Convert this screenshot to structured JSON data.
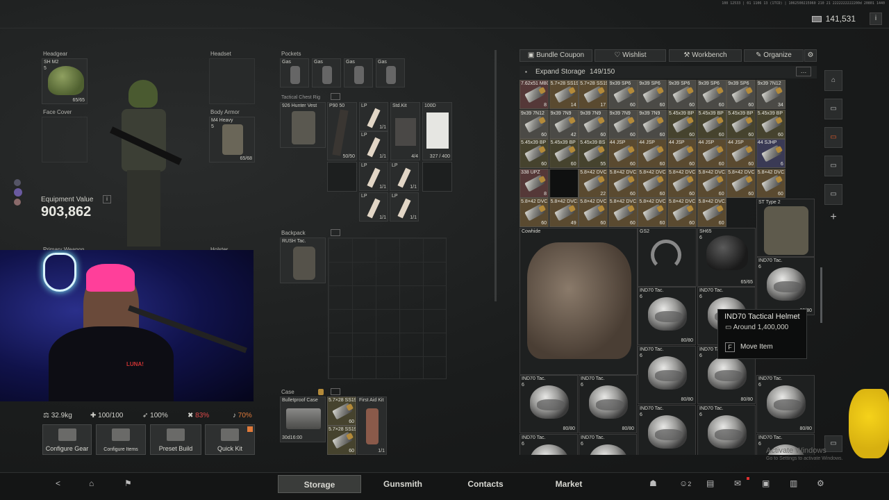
{
  "header": {
    "debug_text": "100 12533 | 01 1106 13 (1TCD) | 1062500215960 210 21 2222222222200d 20801 1440",
    "money": "141,531",
    "info": "i"
  },
  "gear": {
    "headgear_label": "Headgear",
    "headgear_item": "SH M2",
    "headgear_armor": "5",
    "headgear_dur": "65/65",
    "headset_label": "Headset",
    "face_label": "Face Cover",
    "body_label": "Body Armor",
    "body_item": "M4 Heavy",
    "body_armor": "5",
    "body_dur": "65/68",
    "equipment_value_label": "Equipment Value",
    "equipment_value": "903,862",
    "primary_label": "Primary Weapon",
    "holster_label": "Holster"
  },
  "pockets": {
    "label": "Pockets",
    "items": [
      "Gas",
      "Gas",
      "Gas",
      "Gas"
    ]
  },
  "rig": {
    "label": "Tactical Chest Rig",
    "vest": "926 Hunter Vest",
    "p90": "P90 50",
    "p90_count": "50/50",
    "lp": "LP",
    "lp_count": "1/1",
    "stdkit": "Std.Kit",
    "stdkit_count": "4/4",
    "kit100d": "100D",
    "kit100d_count": "327 / 400"
  },
  "backpack": {
    "label": "Backpack",
    "item": "RUSH Tac."
  },
  "case": {
    "label": "Case",
    "item": "Bulletproof Case",
    "timer": "30d16:00",
    "ammo1": "5.7×28 SS190",
    "ammo1_count": "60",
    "ammo2": "5.7×28 SS190",
    "ammo2_count": "60",
    "firstaid": "First Aid Kit",
    "firstaid_count": "1/1"
  },
  "stats": {
    "weight": "32.9kg",
    "health": "100/100",
    "stamina": "100%",
    "hydration": "83%",
    "energy": "70%"
  },
  "actions": [
    "Configure Gear",
    "Configure Items",
    "Preset Build",
    "Quick Kit"
  ],
  "storage": {
    "buttons": [
      "Bundle Coupon",
      "Wishlist",
      "Workbench",
      "Organize"
    ],
    "expand": "Expand Storage",
    "capacity": "149/150",
    "more": "…",
    "rows": [
      [
        [
          "7.62x51 M80",
          "8",
          "g4"
        ],
        [
          "5.7×28 SS190",
          "14",
          "g1"
        ],
        [
          "5.7×28 SS190",
          "17",
          "g1"
        ],
        [
          "9x39 SP6",
          "60",
          "g2"
        ],
        [
          "9x39 SP6",
          "60",
          "g2"
        ],
        [
          "9x39 SP6",
          "60",
          "g2"
        ],
        [
          "9x39 SP6",
          "60",
          "g2"
        ],
        [
          "9x39 SP6",
          "60",
          "g2"
        ],
        [
          "9x39 7N12",
          "34",
          "g2"
        ]
      ],
      [
        [
          "9x39 7N12",
          "60",
          "g2"
        ],
        [
          "9x39 7N9",
          "42",
          "g2"
        ],
        [
          "9x39 7N9",
          "60",
          "g2"
        ],
        [
          "9x39 7N9",
          "60",
          "g2"
        ],
        [
          "9x39 7N9",
          "60",
          "g2"
        ],
        [
          "5.45x39 BP",
          "60",
          "g5"
        ],
        [
          "5.45x39 BP",
          "60",
          "g5"
        ],
        [
          "5.45x39 BP",
          "60",
          "g5"
        ],
        [
          "5.45x39 BP",
          "60",
          "g5"
        ]
      ],
      [
        [
          "5.45x39 BP",
          "60",
          "g5"
        ],
        [
          "5.45x39 BP",
          "60",
          "g5"
        ],
        [
          "5.45x39 BS",
          "55",
          "g5"
        ],
        [
          "44 JSP",
          "60",
          "g1"
        ],
        [
          "44 JSP",
          "60",
          "g1"
        ],
        [
          "44 JSP",
          "60",
          "g1"
        ],
        [
          "44 JSP",
          "60",
          "g1"
        ],
        [
          "44 JSP",
          "60",
          "g1"
        ],
        [
          "44 SJHP",
          "6",
          "g3"
        ]
      ],
      [
        [
          "338 UPZ",
          "8",
          "g4"
        ],
        [
          "",
          "",
          ""
        ],
        [
          "5.8×42 DVC12",
          "22",
          "g1"
        ],
        [
          "5.8×42 DVC12",
          "60",
          "g1"
        ],
        [
          "5.8×42 DVC12",
          "60",
          "g1"
        ],
        [
          "5.8×42 DVC12",
          "60",
          "g1"
        ],
        [
          "5.8×42 DVC12",
          "60",
          "g1"
        ],
        [
          "5.8×42 DVC12",
          "60",
          "g1"
        ],
        [
          "5.8×42 DVC12",
          "60",
          "g1"
        ]
      ],
      [
        [
          "5.8×42 DVC12",
          "60",
          "g1"
        ],
        [
          "5.8×42 DVC12",
          "49",
          "g1"
        ],
        [
          "5.8×42 DVC12",
          "60",
          "g1"
        ],
        [
          "5.8×42 DVC12",
          "60",
          "g1"
        ],
        [
          "5.8×42 DVC12",
          "60",
          "g1"
        ],
        [
          "5.8×42 DVC12",
          "60",
          "g1"
        ],
        [
          "5.8×42 DVC12",
          "60",
          "g1"
        ]
      ]
    ],
    "st_type": "ST Type 2",
    "cowhide": "Cowhide",
    "gs2": "GS2",
    "sh65": "SH65",
    "sh65_armor": "6",
    "sh65_dur": "65/65",
    "ind70": "IND70 Tac.",
    "ind70_armor": "6",
    "ind70_dur": "80/80"
  },
  "tooltip": {
    "title": "IND70 Tactical Helmet",
    "price": "Around 1,400,000",
    "key": "F",
    "action": "Move Item"
  },
  "stream": {
    "shirt": "LUNA!"
  },
  "watermark": {
    "title": "Activate Windows",
    "sub": "Go to Settings to activate Windows."
  },
  "nav": {
    "tabs": [
      "Storage",
      "Gunsmith",
      "Contacts",
      "Market"
    ],
    "count": "2"
  }
}
